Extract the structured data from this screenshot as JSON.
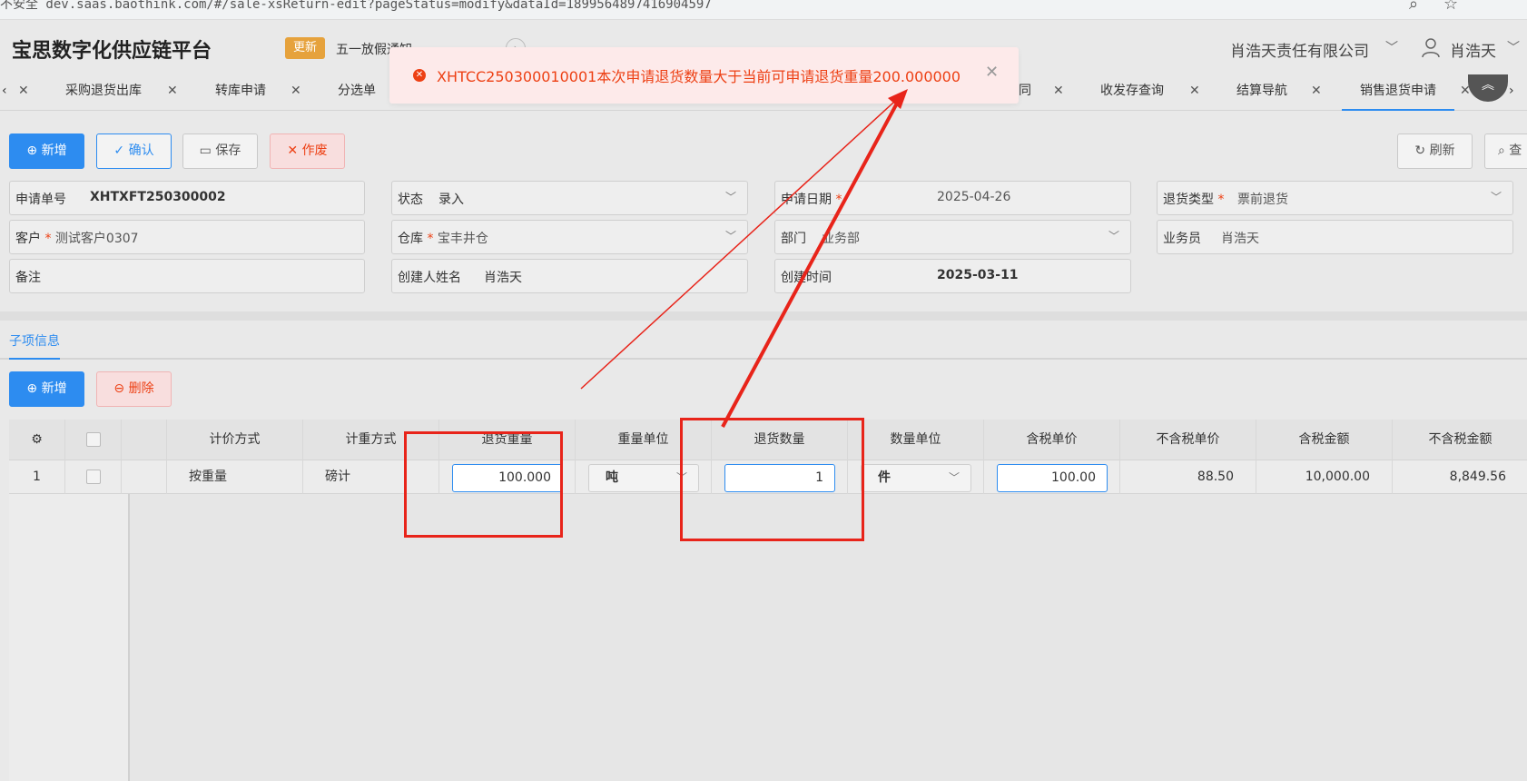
{
  "browser": {
    "url": "不安全   dev.saas.baothink.com/#/sale-xsReturn-edit?pageStatus=modify&dataId=1899564897416904597"
  },
  "header": {
    "title": "宝思数字化供应链平台",
    "update_badge": "更新",
    "notice": "五一放假通知",
    "company": "肖浩天责任有限公司",
    "user": "肖浩天"
  },
  "tabs": [
    {
      "label": "采购退货出库"
    },
    {
      "label": "转库申请"
    },
    {
      "label": "分选单"
    },
    {
      "label": "同"
    },
    {
      "label": "收发存查询"
    },
    {
      "label": "结算导航"
    },
    {
      "label": "销售退货申请",
      "active": true
    }
  ],
  "toast": {
    "message": "XHTCC250300010001本次申请退货数量大于当前可申请退货重量200.000000",
    "color": "#ed4014"
  },
  "toolbar": {
    "add": "新增",
    "confirm": "确认",
    "save": "保存",
    "void": "作废",
    "refresh": "刷新",
    "query": "查"
  },
  "form": {
    "apply_no_label": "申请单号",
    "apply_no": "XHTXFT250300002",
    "status_label": "状态",
    "status": "录入",
    "apply_date_label": "申请日期",
    "apply_date": "2025-04-26",
    "return_type_label": "退货类型",
    "return_type": "票前退货",
    "customer_label": "客户",
    "customer": "测试客户0307",
    "warehouse_label": "仓库",
    "warehouse": "宝丰井仓",
    "dept_label": "部门",
    "dept": "业务部",
    "salesman_label": "业务员",
    "salesman": "肖浩天",
    "remark_label": "备注",
    "creator_label": "创建人姓名",
    "creator": "肖浩天",
    "created_label": "创建时间",
    "created": "2025-03-11",
    "required_mark": "*"
  },
  "subsection": {
    "tab": "子项信息",
    "add": "新增",
    "delete": "删除"
  },
  "table": {
    "headers": [
      "计价方式",
      "计重方式",
      "退货重量",
      "重量单位",
      "退货数量",
      "数量单位",
      "含税单价",
      "不含税单价",
      "含税金额",
      "不含税金额"
    ],
    "rows": [
      {
        "index": "1",
        "pricing": "按重量",
        "weighing": "磅计",
        "return_weight": "100.000",
        "weight_unit": "吨",
        "return_qty": "1",
        "qty_unit": "件",
        "tax_price": "100.00",
        "notax_price": "88.50",
        "tax_amount": "10,000.00",
        "notax_amount": "8,849.56"
      }
    ]
  },
  "colors": {
    "primary": "#2d8cf0",
    "danger": "#ed4014",
    "warning": "#e6a23c",
    "annotation": "#e8241a"
  }
}
